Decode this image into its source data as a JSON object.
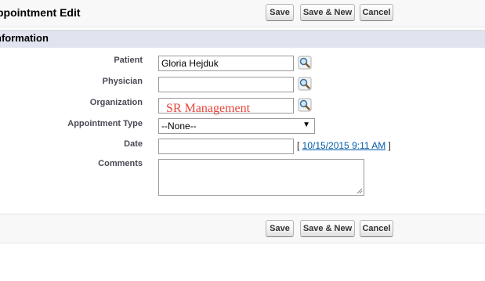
{
  "header": {
    "title": "ppointment Edit"
  },
  "toolbar": {
    "save": "Save",
    "save_new": "Save & New",
    "cancel": "Cancel"
  },
  "section": {
    "title": "nformation"
  },
  "fields": {
    "patient": {
      "label": "Patient",
      "value": "Gloria Hejduk"
    },
    "physician": {
      "label": "Physician",
      "value": ""
    },
    "organization": {
      "label": "Organization",
      "value": "",
      "overlay_text": "SR Management"
    },
    "appointment_type": {
      "label": "Appointment Type",
      "selected": "--None--"
    },
    "date": {
      "label": "Date",
      "value": "",
      "default_prefix": "[ ",
      "default_link": "10/15/2015 9:11 AM",
      "default_suffix": " ]"
    },
    "comments": {
      "label": "Comments",
      "value": ""
    }
  },
  "colors": {
    "overlay": "#e8463c",
    "link": "#015ba7",
    "section_bg": "#e1e4ee"
  },
  "icons": {
    "lookup": "magnifier-lookup-icon",
    "dropdown": "chevron-down-icon",
    "resize": "resize-grip-icon"
  }
}
